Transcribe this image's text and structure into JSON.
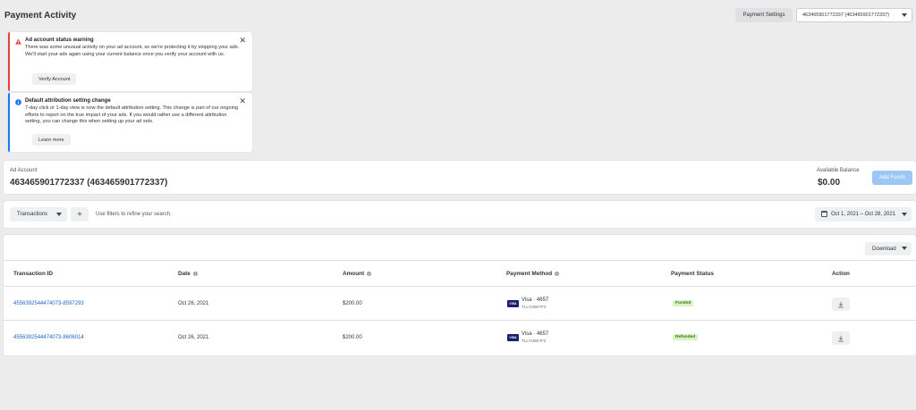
{
  "header": {
    "title": "Payment Activity",
    "settings_label": "Payment Settings",
    "account_selector": "463465901772337 (463465901772337)"
  },
  "alerts": [
    {
      "title": "Ad account status warning",
      "body": "There was some unusual activity on your ad account, so we're protecting it by stopping your ads. We'll start your ads again using your current balance once you verify your account with us.",
      "button": "Verify Account",
      "type": "warning",
      "color": "#e0443e"
    },
    {
      "title": "Default attribution setting change",
      "body": "7-day click or 1-day view is now the default attribution setting. This change is part of our ongoing efforts to report on the true impact of your ads. If you would rather use a different attribution setting, you can change this when setting up your ad sets.",
      "button": "Learn more",
      "type": "info",
      "color": "#1877f2"
    }
  ],
  "account": {
    "label": "Ad Account",
    "value": "463465901772337 (463465901772337)",
    "balance_label": "Available Balance",
    "balance_value": "$0.00",
    "add_funds_label": "Add Funds"
  },
  "filters": {
    "transactions_label": "Transactions",
    "hint": "Use filters to refine your search.",
    "date_range": "Oct 1, 2021 – Oct 28, 2021"
  },
  "table": {
    "download_label": "Download",
    "columns": [
      "Transaction ID",
      "Date",
      "Amount",
      "Payment Method",
      "Payment Status",
      "Action"
    ],
    "rows": [
      {
        "id": "4556392544474073-8597293",
        "date": "Oct 26, 2021",
        "amount": "$200.00",
        "card_brand": "VISA",
        "method": "Visa · 4657",
        "method_sub": "TLLYU9K7F2",
        "status": "Funded"
      },
      {
        "id": "4556392544474073-8606014",
        "date": "Oct 26, 2021",
        "amount": "$200.00",
        "card_brand": "VISA",
        "method": "Visa · 4657",
        "method_sub": "TLLYU9K7F2",
        "status": "Refunded"
      }
    ]
  },
  "colors": {
    "link": "#1a66c8",
    "status_bg": "#d9f2c4",
    "status_text": "#3b7a1a",
    "add_funds_bg": "#9cc6f4"
  }
}
